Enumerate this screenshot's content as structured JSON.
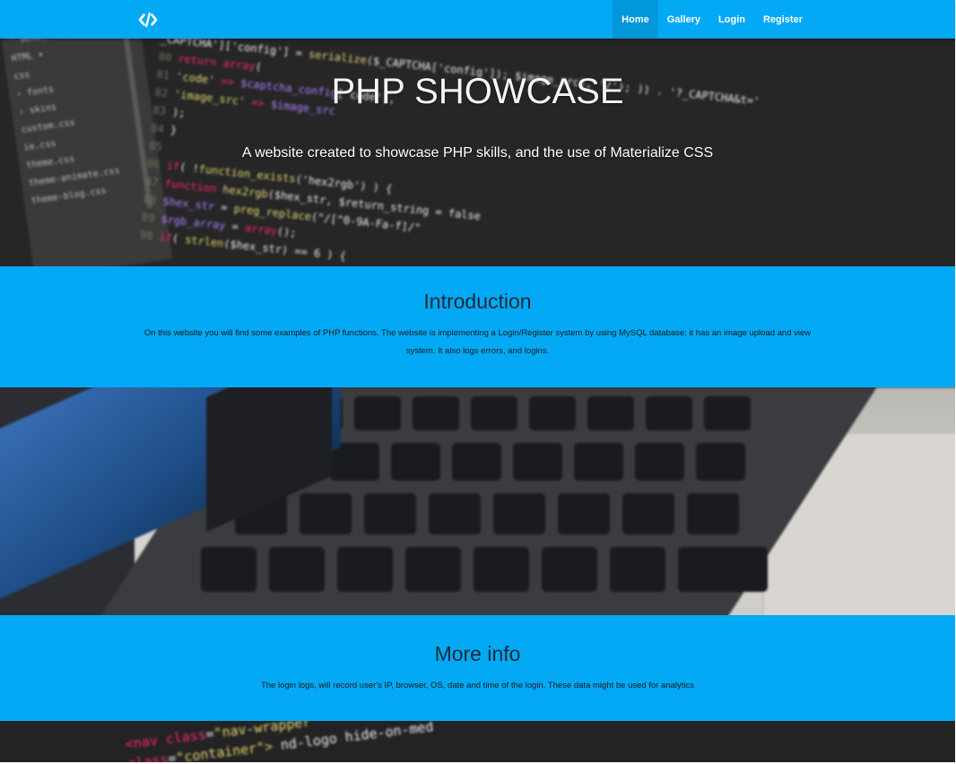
{
  "nav": {
    "logo_icon": "code-icon",
    "links": [
      {
        "label": "Home",
        "active": true
      },
      {
        "label": "Gallery",
        "active": false
      },
      {
        "label": "Login",
        "active": false
      },
      {
        "label": "Register",
        "active": false
      }
    ]
  },
  "hero": {
    "title": "PHP SHOWCASE",
    "subtitle": "A website created to showcase PHP skills, and the use of Materialize CSS"
  },
  "intro": {
    "title": "Introduction",
    "text": "On this website you will find some examples of PHP functions. The website is implementing a Login/Register system by using MySQL database; it has an image upload and view system. It also logs errors, and logins."
  },
  "more_info": {
    "title": "More info",
    "text": "The login logs, will record user's IP, browser, OS, date and time of the login. These data might be used for analytics"
  },
  "colors": {
    "primary": "#03a9f4",
    "heading_text": "#1c2a36"
  }
}
